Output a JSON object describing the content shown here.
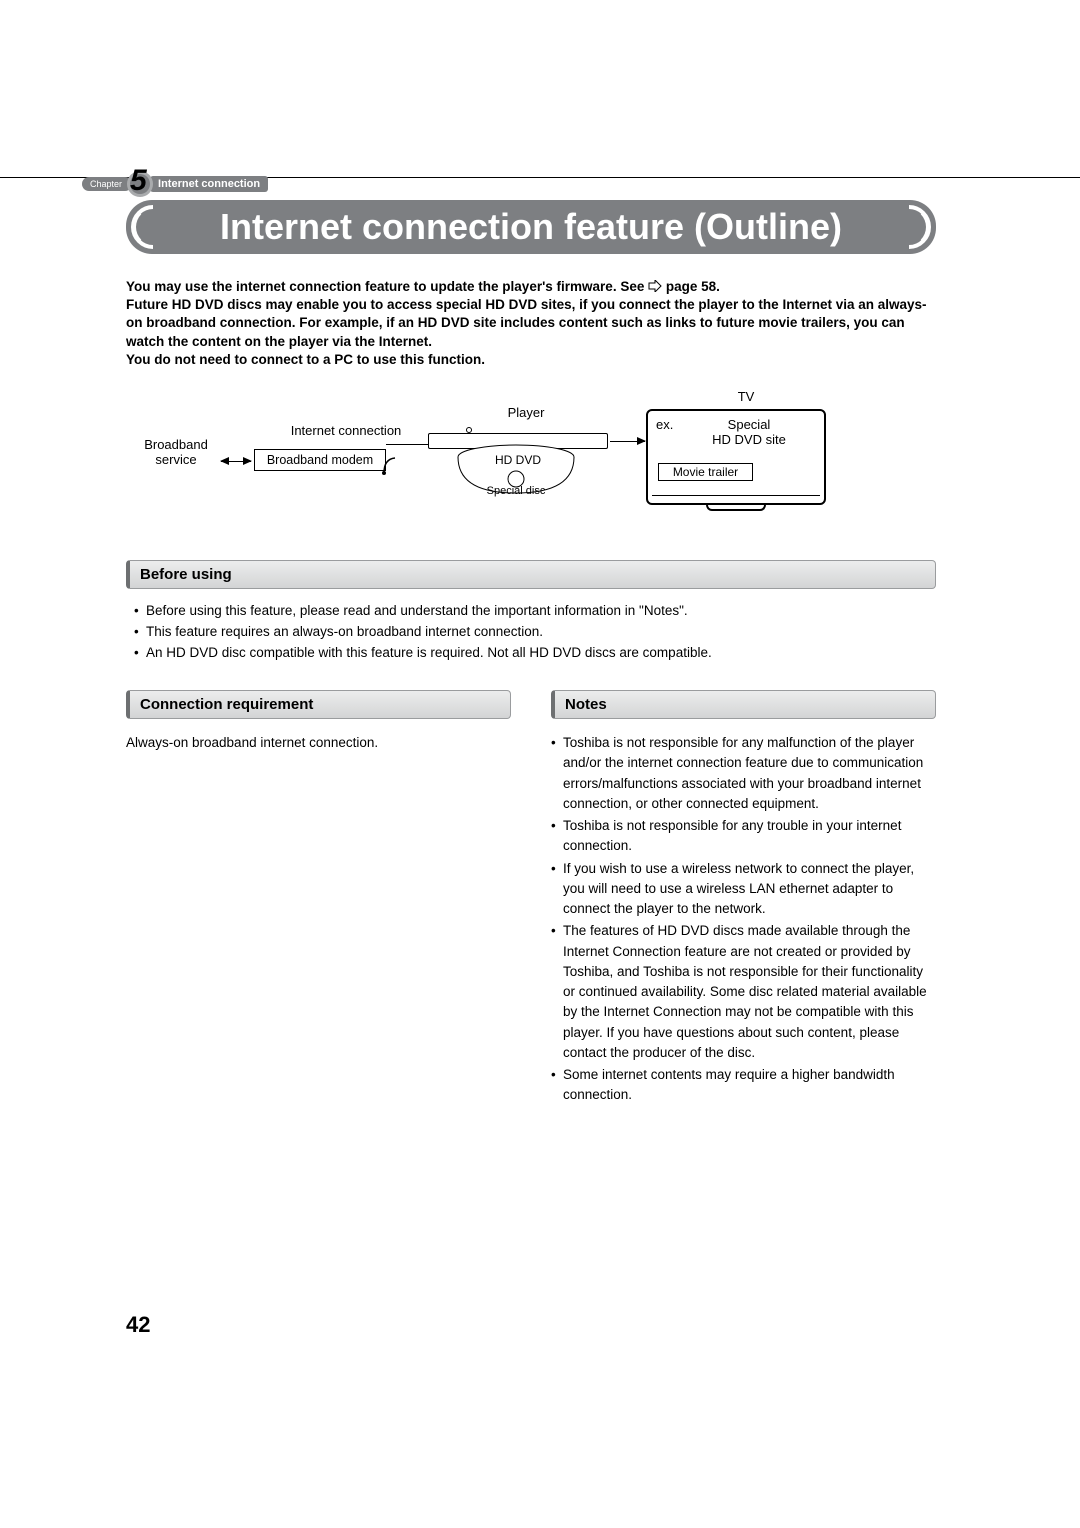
{
  "chapter": {
    "label": "Chapter",
    "number": "5",
    "section": "Internet connection"
  },
  "title": "Internet connection feature (Outline)",
  "intro_lines": [
    "You may use the internet connection feature to update the player's firmware. See",
    "page 58.",
    "Future HD DVD discs may enable you to access special HD DVD sites, if you connect the player to the Internet via an always-on broadband connection. For example, if an HD DVD site includes content such as links to future movie trailers, you can watch the content on the player via the Internet.",
    "You do not need to connect to a PC to use this function."
  ],
  "diagram": {
    "broadband_service": "Broadband\nservice",
    "broadband_modem": "Broadband modem",
    "internet_connection": "Internet connection",
    "player": "Player",
    "hd_dvd": "HD DVD",
    "special_disc": "Special disc",
    "tv": "TV",
    "ex": "ex.",
    "special_site": "Special\nHD DVD site",
    "movie_trailer": "Movie trailer"
  },
  "sections": {
    "before_using": {
      "heading": "Before using",
      "bullets": [
        "Before using this feature, please read and understand the important information in \"Notes\".",
        "This feature requires an always-on broadband internet connection.",
        "An HD DVD disc compatible with this feature is required. Not all HD DVD discs are compatible."
      ]
    },
    "connection_requirement": {
      "heading": "Connection requirement",
      "body": "Always-on broadband internet connection."
    },
    "notes": {
      "heading": "Notes",
      "bullets": [
        "Toshiba is not responsible for any malfunction of the player and/or the internet connection feature due to communication errors/malfunctions associated with your broadband internet connection, or other connected equipment.",
        "Toshiba is not responsible for any trouble in your internet connection.",
        "If you wish to use a wireless network to connect the player, you will need to use a wireless LAN ethernet adapter to connect the player to the network.",
        "The features of HD DVD discs made available through the Internet Connection feature are not created or provided by Toshiba, and Toshiba is not responsible for their functionality or continued availability. Some disc related material available by the Internet Connection may not be compatible with this player. If you have questions about such content, please contact the producer of the disc.",
        "Some internet contents may require a higher bandwidth connection."
      ]
    }
  },
  "page_number": "42"
}
